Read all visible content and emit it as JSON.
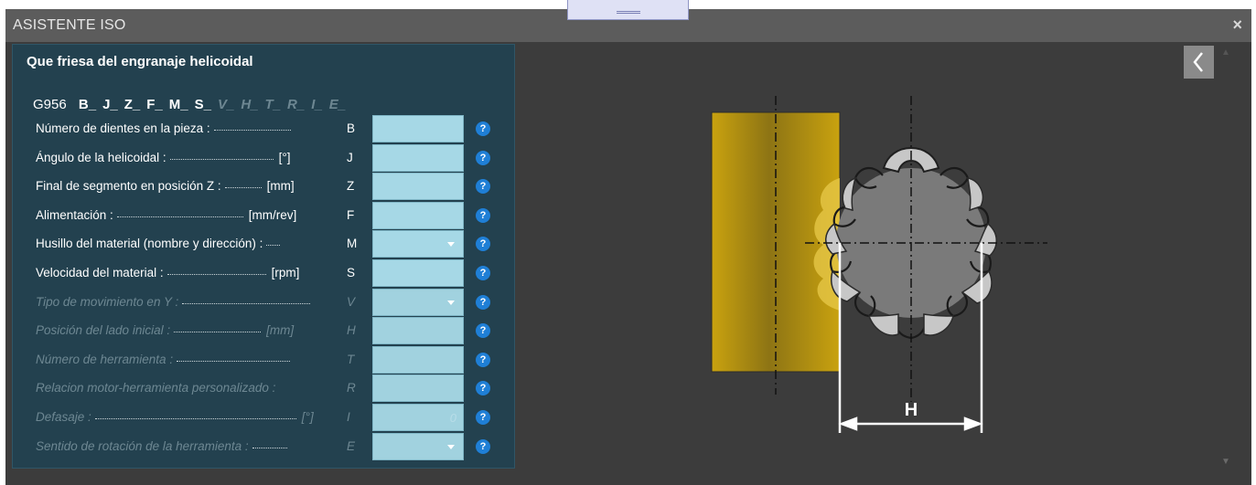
{
  "window": {
    "title": "ASISTENTE ISO",
    "close_glyph": "×"
  },
  "panel": {
    "title": "Que friesa del engranaje helicoidal",
    "code": {
      "prefix": "G956",
      "params": [
        {
          "text": "B_",
          "active": true
        },
        {
          "text": "J_",
          "active": true
        },
        {
          "text": "Z_",
          "active": true
        },
        {
          "text": "F_",
          "active": true
        },
        {
          "text": "M_",
          "active": true
        },
        {
          "text": "S_",
          "active": true
        },
        {
          "text": "V_",
          "active": false
        },
        {
          "text": "H_",
          "active": false
        },
        {
          "text": "T_",
          "active": false
        },
        {
          "text": "R_",
          "active": false
        },
        {
          "text": "I_",
          "active": false
        },
        {
          "text": "E_",
          "active": false
        }
      ]
    },
    "rows": [
      {
        "label": "Número de dientes en la pieza :",
        "unit": "",
        "letter": "B",
        "type": "input",
        "value": "",
        "enabled": true
      },
      {
        "label": "Ángulo de la helicoidal :",
        "unit": "[°]",
        "letter": "J",
        "type": "input",
        "value": "",
        "enabled": true
      },
      {
        "label": "Final de segmento en posición Z :",
        "unit": "[mm]",
        "letter": "Z",
        "type": "input",
        "value": "",
        "enabled": true
      },
      {
        "label": "Alimentación :",
        "unit": "[mm/rev]",
        "letter": "F",
        "type": "input",
        "value": "",
        "enabled": true
      },
      {
        "label": "Husillo del material (nombre y dirección) :",
        "unit": "",
        "letter": "M",
        "type": "select",
        "value": "",
        "enabled": true
      },
      {
        "label": "Velocidad del material :",
        "unit": "[rpm]",
        "letter": "S",
        "type": "input",
        "value": "",
        "enabled": true
      },
      {
        "label": "Tipo de movimiento en Y :",
        "unit": "",
        "letter": "V",
        "type": "select",
        "value": "",
        "enabled": false
      },
      {
        "label": "Posición del lado inicial :",
        "unit": "[mm]",
        "letter": "H",
        "type": "input",
        "value": "",
        "enabled": false
      },
      {
        "label": "Número de herramienta :",
        "unit": "",
        "letter": "T",
        "type": "input",
        "value": "",
        "enabled": false
      },
      {
        "label": "Relacion motor-herramienta personalizado :",
        "unit": "",
        "letter": "R",
        "type": "input",
        "value": "",
        "enabled": false
      },
      {
        "label": "Defasaje :",
        "unit": "[°]",
        "letter": "I",
        "type": "input",
        "value": "0",
        "enabled": false
      },
      {
        "label": "Sentido de rotación de la herramienta :",
        "unit": "",
        "letter": "E",
        "type": "select",
        "value": "",
        "enabled": false
      }
    ],
    "help_glyph": "?"
  },
  "diagram": {
    "dimension_label": "H"
  },
  "icons": {
    "back": "chevron-left-icon",
    "help": "question-icon",
    "close": "close-icon",
    "scroll_up": "scroll-up-icon",
    "scroll_down": "scroll-down-icon"
  },
  "colors": {
    "titlebar": "#5c5c5c",
    "background": "#3c3c3c",
    "panel": "#23414f",
    "field": "#a6d8e6",
    "help": "#1f7fd6",
    "workpiece": "#c9a20f",
    "gear": "#7a7a7a"
  }
}
